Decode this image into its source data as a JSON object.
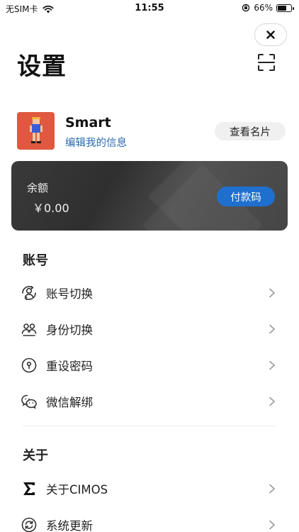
{
  "status_bar": {
    "carrier": "无SIM卡",
    "time": "11:55",
    "battery": "66%"
  },
  "header": {
    "title": "设置"
  },
  "profile": {
    "name": "Smart",
    "edit_link": "编辑我的信息",
    "card_button": "查看名片"
  },
  "balance": {
    "label": "余额",
    "value": "￥0.00",
    "pay_button": "付款码"
  },
  "sections": {
    "account": {
      "title": "账号",
      "items": [
        {
          "label": "账号切换",
          "icon": "account-switch-icon"
        },
        {
          "label": "身份切换",
          "icon": "identity-switch-icon"
        },
        {
          "label": "重设密码",
          "icon": "lock-icon"
        },
        {
          "label": "微信解绑",
          "icon": "wechat-icon"
        }
      ]
    },
    "about": {
      "title": "关于",
      "items": [
        {
          "label": "关于CIMOS",
          "icon": "sigma-icon"
        },
        {
          "label": "系统更新",
          "icon": "refresh-icon"
        }
      ]
    }
  },
  "colors": {
    "accent": "#1f6fcf",
    "link": "#2b6cb0",
    "card_bg": "#3a3a3a",
    "avatar_bg": "#e0583f"
  }
}
